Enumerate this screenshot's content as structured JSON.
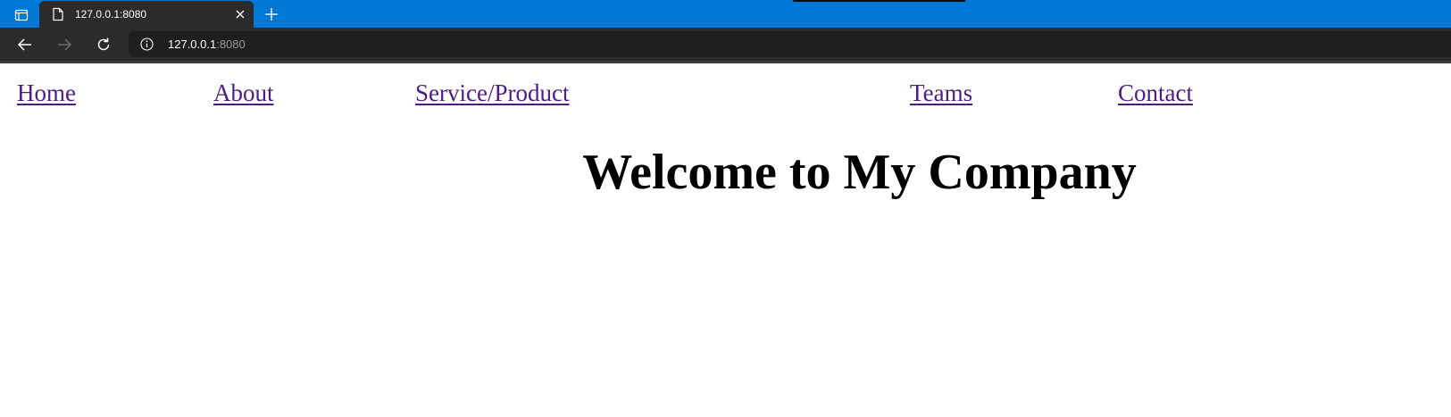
{
  "browser": {
    "tab": {
      "title": "127.0.0.1:8080",
      "icon": "page-icon"
    },
    "address": {
      "host": "127.0.0.1",
      "port": ":8080",
      "icon": "info-icon"
    },
    "colors": {
      "tabstrip": "#0078d7",
      "toolbar": "#2b2b2b",
      "address_bg": "#1f1f1f"
    }
  },
  "nav": {
    "links": [
      {
        "label": "Home"
      },
      {
        "label": "About"
      },
      {
        "label": "Service/Product"
      },
      {
        "label": "Teams"
      },
      {
        "label": "Contact"
      }
    ],
    "link_color": "#4b1d83"
  },
  "main": {
    "title": "Welcome to My Company"
  }
}
